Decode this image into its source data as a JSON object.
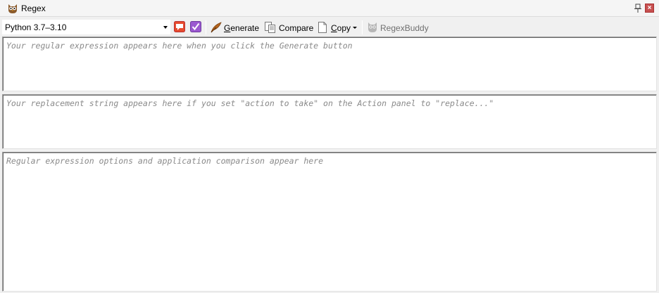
{
  "window": {
    "title": "Regex",
    "app_icon": "owl-icon",
    "pin_icon": "pin-icon",
    "close_label": "×"
  },
  "toolbar": {
    "flavor_select": {
      "value": "Python 3.7–3.10"
    },
    "icons": {
      "comment": "comment-icon",
      "check": "checkmark-icon"
    },
    "generate": {
      "mnemonic": "G",
      "rest": "enerate",
      "icon": "quill-icon"
    },
    "compare": {
      "label": "Compare",
      "icon": "compare-icon"
    },
    "copy": {
      "mnemonic": "C",
      "rest": "opy",
      "icon": "copy-icon"
    },
    "regexbuddy": {
      "label": "RegexBuddy",
      "icon": "owl-icon"
    }
  },
  "panels": {
    "regex_placeholder": "Your regular expression appears here when you click the Generate button",
    "replacement_placeholder": "Your replacement string appears here if you set \"action to take\" on the Action panel to \"replace...\"",
    "options_placeholder": "Regular expression options and application comparison appear here"
  }
}
